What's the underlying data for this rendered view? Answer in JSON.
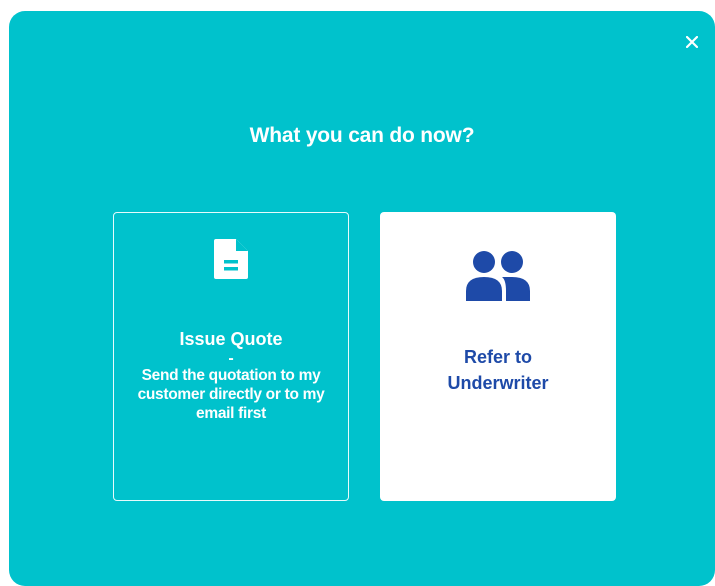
{
  "dialog": {
    "title": "What you can do now?",
    "close_icon": "close-icon",
    "background_color": "#00c2cc"
  },
  "options": {
    "issue_quote": {
      "icon": "document-icon",
      "title": "Issue Quote",
      "separator": "-",
      "description": "Send the quotation to my customer directly or to my email first"
    },
    "refer_underwriter": {
      "icon": "users-icon",
      "label_line1": "Refer to",
      "label_line2": "Underwriter",
      "accent_color": "#1e4aa8"
    }
  }
}
